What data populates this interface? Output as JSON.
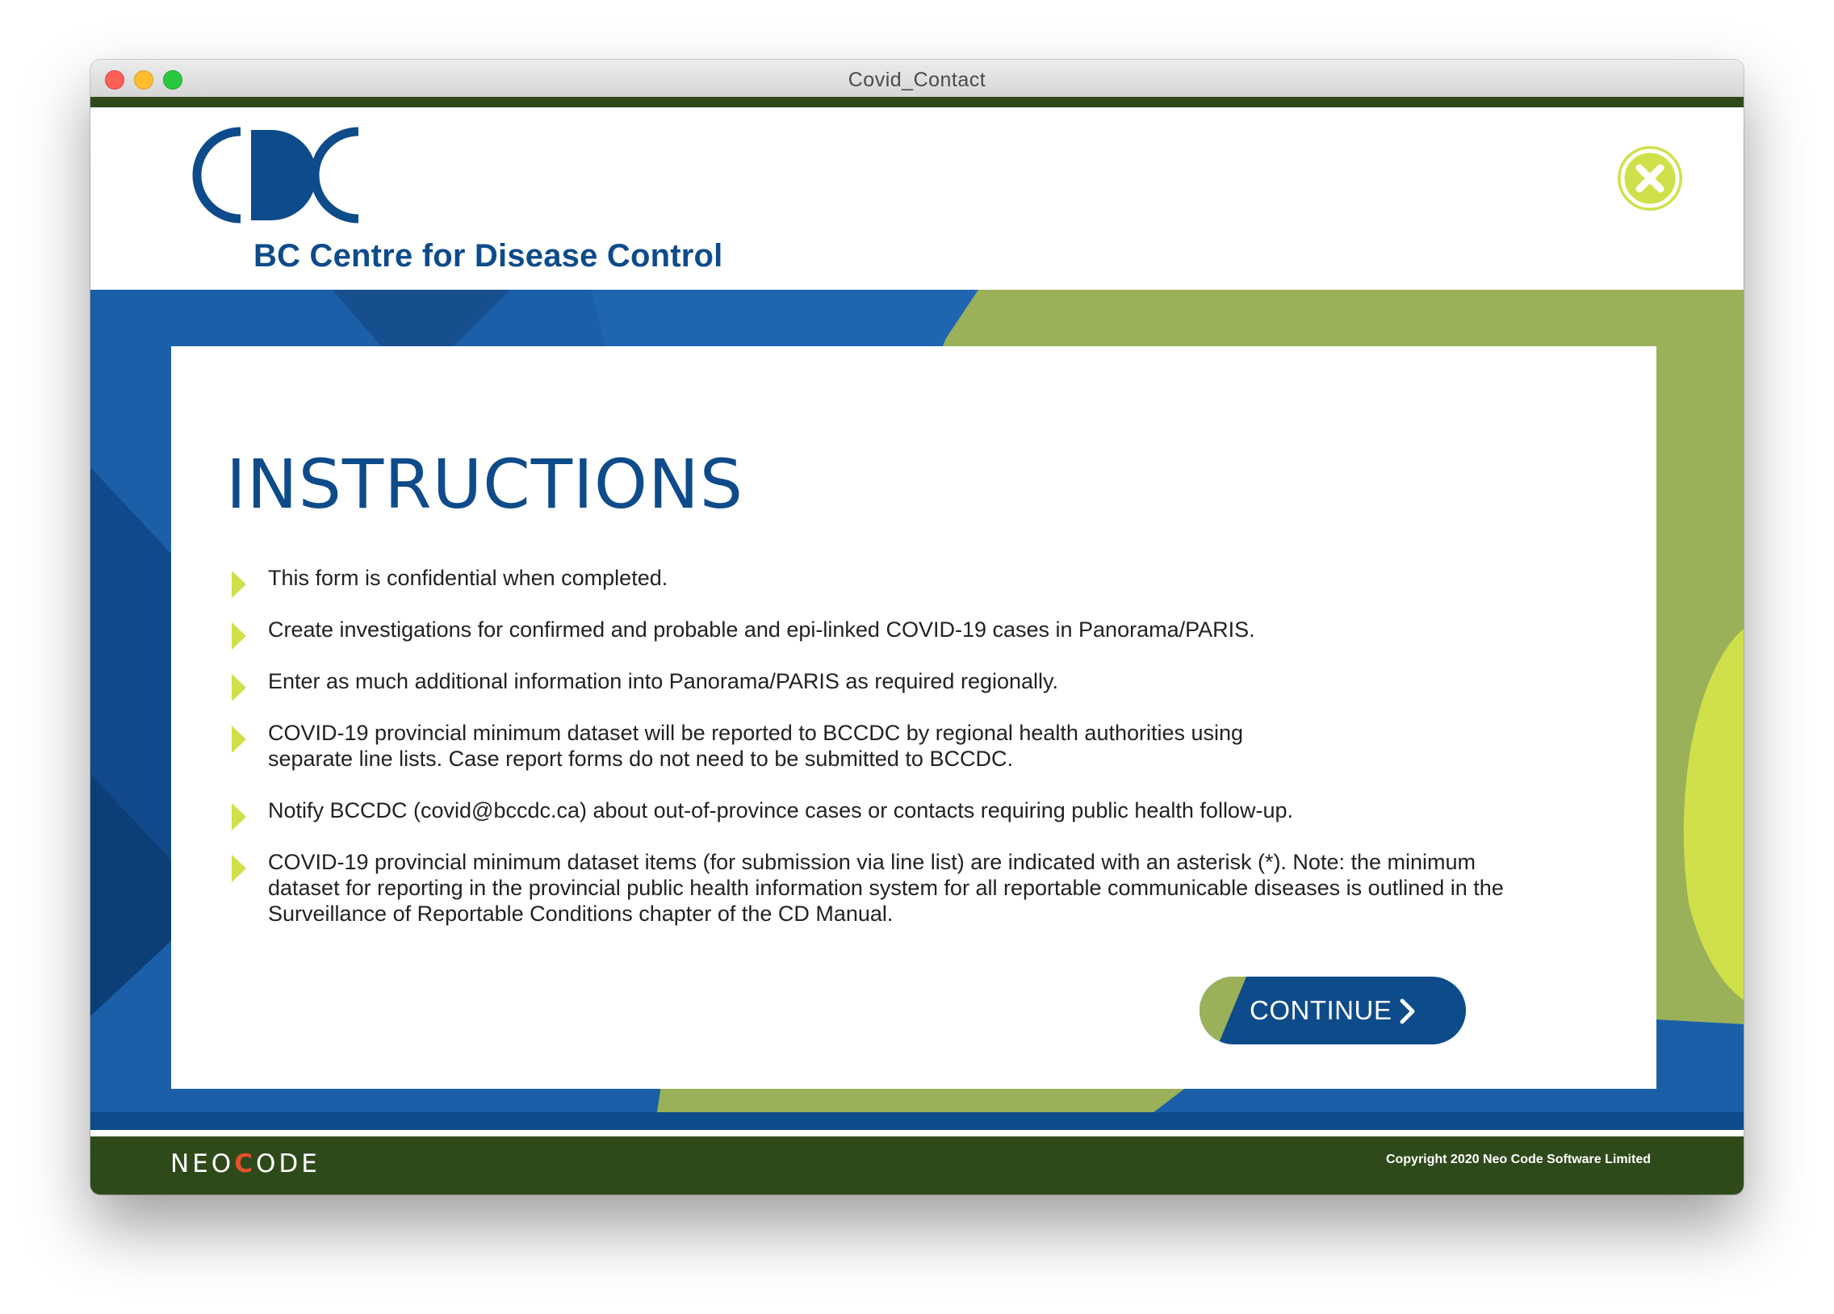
{
  "window": {
    "title": "Covid_Contact"
  },
  "header": {
    "org_name": "BC Centre for Disease Control",
    "logo_icon": "cdc-logo-icon",
    "close_icon": "close-x-circle-icon"
  },
  "instructions": {
    "title": "INSTRUCTIONS",
    "items": [
      {
        "text": "This form is confidential when completed."
      },
      {
        "text": "Create investigations for confirmed and probable and epi-linked COVID-19 cases in Panorama/PARIS."
      },
      {
        "text": "Enter as much additional information into Panorama/PARIS as required regionally."
      },
      {
        "line1": "COVID-19 provincial minimum dataset will be reported to BCCDC by regional health authorities using",
        "line2": "separate line lists. Case report forms do not need to be submitted to BCCDC."
      },
      {
        "text": "Notify BCCDC (covid@bccdc.ca) about out-of-province cases or contacts requiring public health follow-up."
      },
      {
        "line1": "COVID-19 provincial minimum dataset items (for submission via line list) are indicated with an asterisk (*). Note: the minimum",
        "line2": "dataset for reporting in the provincial public health information system for all reportable communicable diseases is outlined in the",
        "line3": "Surveillance of Reportable Conditions chapter of the CD Manual."
      }
    ],
    "bullet_icon": "triangle-bullet-icon"
  },
  "continue_button": {
    "label": "CONTINUE",
    "icon": "chevron-right-icon"
  },
  "footer": {
    "brand_part1": "NEO",
    "brand_accent": "C",
    "brand_part2": "ODE",
    "copyright": "Copyright 2020 Neo Code Software Limited"
  },
  "colors": {
    "brand_blue": "#0e4b8a",
    "accent_lime": "#cfe04a",
    "olive_green": "#9bb159",
    "dark_green": "#2e4a1a",
    "neocode_orange": "#e6502a"
  }
}
